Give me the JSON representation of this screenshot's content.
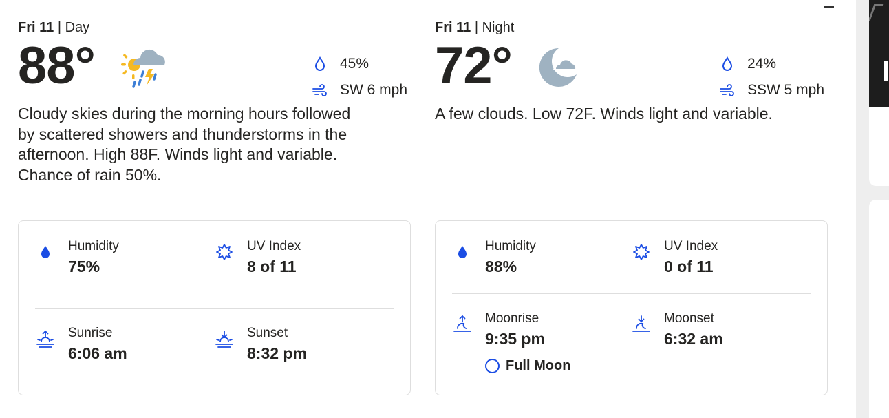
{
  "day": {
    "date": "Fri 11",
    "separator": "|",
    "period": "Day",
    "temperature": "88°",
    "condition_icon": "scattered-thunderstorms-icon",
    "precip": "45%",
    "wind": "SW 6 mph",
    "narrative": "Cloudy skies during the morning hours followed by scattered showers and thunderstorms in the afternoon. High 88F. Winds light and variable. Chance of rain 50%.",
    "details": {
      "humidity_label": "Humidity",
      "humidity_value": "75%",
      "uv_label": "UV Index",
      "uv_value": "8 of 11",
      "sunrise_label": "Sunrise",
      "sunrise_value": "6:06 am",
      "sunset_label": "Sunset",
      "sunset_value": "8:32 pm"
    }
  },
  "night": {
    "date": "Fri 11",
    "separator": "|",
    "period": "Night",
    "temperature": "72°",
    "condition_icon": "partly-cloudy-night-icon",
    "precip": "24%",
    "wind": "SSW 5 mph",
    "narrative": "A few clouds. Low 72F. Winds light and variable.",
    "details": {
      "humidity_label": "Humidity",
      "humidity_value": "88%",
      "uv_label": "UV Index",
      "uv_value": "0 of 11",
      "moonrise_label": "Moonrise",
      "moonrise_value": "9:35 pm",
      "moonset_label": "Moonset",
      "moonset_value": "6:32 am",
      "moon_phase": "Full Moon"
    }
  },
  "colors": {
    "accent": "#1b4de4",
    "text": "#252422",
    "border": "#dedede",
    "cloud": "#9fb2c1",
    "sun": "#f5b922"
  }
}
